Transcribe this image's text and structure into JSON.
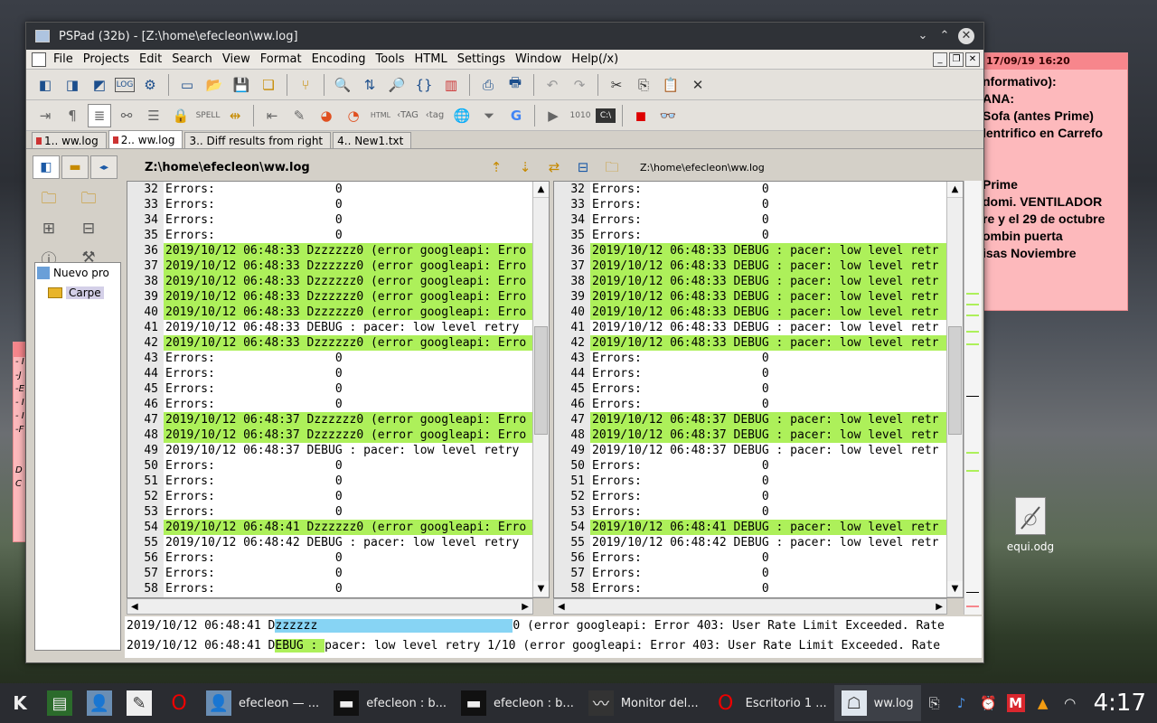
{
  "sticky_note": {
    "header": "17/09/19 16:20",
    "lines": [
      "nformativo):",
      "ANA:",
      "Sofa (antes Prime)",
      "lentrifico en Carrefo",
      "",
      "",
      "Prime",
      "domi. VENTILADOR",
      "re y el 29 de octubre",
      "ombin puerta",
      "isas Noviembre"
    ]
  },
  "left_sticky_lines": [
    "- I",
    "-J",
    "-E",
    "- I",
    "- I",
    "-F",
    "",
    "",
    "D",
    "C"
  ],
  "desktop_icon": {
    "label": "equi.odg"
  },
  "window": {
    "title": "PSPad (32b) - [Z:\\home\\efecleon\\ww.log]",
    "menu": [
      "File",
      "Projects",
      "Edit",
      "Search",
      "View",
      "Format",
      "Encoding",
      "Tools",
      "HTML",
      "Settings",
      "Window",
      "Help(/x)"
    ],
    "tabs": [
      {
        "label": "1.. ww.log",
        "active": false
      },
      {
        "label": "2.. ww.log",
        "active": true
      },
      {
        "label": "3.. Diff results from right",
        "active": false
      },
      {
        "label": "4.. New1.txt",
        "active": false
      }
    ],
    "path_left": "Z:\\home\\efecleon\\ww.log",
    "path_right": "Z:\\home\\efecleon\\ww.log",
    "tree": {
      "item1": "Nuevo pro",
      "item2": "Carpe"
    }
  },
  "left_pane": [
    {
      "n": "32",
      "t": "Errors:                 0",
      "hl": false
    },
    {
      "n": "33",
      "t": "Errors:                 0",
      "hl": false
    },
    {
      "n": "34",
      "t": "Errors:                 0",
      "hl": false
    },
    {
      "n": "35",
      "t": "Errors:                 0",
      "hl": false
    },
    {
      "n": "36",
      "t": "2019/10/12 06:48:33 Dzzzzzz0 (error googleapi: Erro",
      "hl": true
    },
    {
      "n": "37",
      "t": "2019/10/12 06:48:33 Dzzzzzz0 (error googleapi: Erro",
      "hl": true
    },
    {
      "n": "38",
      "t": "2019/10/12 06:48:33 Dzzzzzz0 (error googleapi: Erro",
      "hl": true
    },
    {
      "n": "39",
      "t": "2019/10/12 06:48:33 Dzzzzzz0 (error googleapi: Erro",
      "hl": true
    },
    {
      "n": "40",
      "t": "2019/10/12 06:48:33 Dzzzzzz0 (error googleapi: Erro",
      "hl": true
    },
    {
      "n": "41",
      "t": "2019/10/12 06:48:33 DEBUG : pacer: low level retry ",
      "hl": false
    },
    {
      "n": "42",
      "t": "2019/10/12 06:48:33 Dzzzzzz0 (error googleapi: Erro",
      "hl": true
    },
    {
      "n": "43",
      "t": "Errors:                 0",
      "hl": false
    },
    {
      "n": "44",
      "t": "Errors:                 0",
      "hl": false
    },
    {
      "n": "45",
      "t": "Errors:                 0",
      "hl": false
    },
    {
      "n": "46",
      "t": "Errors:                 0",
      "hl": false
    },
    {
      "n": "47",
      "t": "2019/10/12 06:48:37 Dzzzzzz0 (error googleapi: Erro",
      "hl": true
    },
    {
      "n": "48",
      "t": "2019/10/12 06:48:37 Dzzzzzz0 (error googleapi: Erro",
      "hl": true
    },
    {
      "n": "49",
      "t": "2019/10/12 06:48:37 DEBUG : pacer: low level retry ",
      "hl": false
    },
    {
      "n": "50",
      "t": "Errors:                 0",
      "hl": false
    },
    {
      "n": "51",
      "t": "Errors:                 0",
      "hl": false
    },
    {
      "n": "52",
      "t": "Errors:                 0",
      "hl": false
    },
    {
      "n": "53",
      "t": "Errors:                 0",
      "hl": false
    },
    {
      "n": "54",
      "t": "2019/10/12 06:48:41 Dzzzzzz0 (error googleapi: Erro",
      "hl": true
    },
    {
      "n": "55",
      "t": "2019/10/12 06:48:42 DEBUG : pacer: low level retry ",
      "hl": false
    },
    {
      "n": "56",
      "t": "Errors:                 0",
      "hl": false
    },
    {
      "n": "57",
      "t": "Errors:                 0",
      "hl": false
    },
    {
      "n": "58",
      "t": "Errors:                 0",
      "hl": false
    }
  ],
  "right_pane": [
    {
      "n": "32",
      "t": "Errors:                 0",
      "hl": false
    },
    {
      "n": "33",
      "t": "Errors:                 0",
      "hl": false
    },
    {
      "n": "34",
      "t": "Errors:                 0",
      "hl": false
    },
    {
      "n": "35",
      "t": "Errors:                 0",
      "hl": false
    },
    {
      "n": "36",
      "t": "2019/10/12 06:48:33 DEBUG : pacer: low level retr",
      "hl": true
    },
    {
      "n": "37",
      "t": "2019/10/12 06:48:33 DEBUG : pacer: low level retr",
      "hl": true
    },
    {
      "n": "38",
      "t": "2019/10/12 06:48:33 DEBUG : pacer: low level retr",
      "hl": true
    },
    {
      "n": "39",
      "t": "2019/10/12 06:48:33 DEBUG : pacer: low level retr",
      "hl": true
    },
    {
      "n": "40",
      "t": "2019/10/12 06:48:33 DEBUG : pacer: low level retr",
      "hl": true
    },
    {
      "n": "41",
      "t": "2019/10/12 06:48:33 DEBUG : pacer: low level retr",
      "hl": false
    },
    {
      "n": "42",
      "t": "2019/10/12 06:48:33 DEBUG : pacer: low level retr",
      "hl": true
    },
    {
      "n": "43",
      "t": "Errors:                 0",
      "hl": false
    },
    {
      "n": "44",
      "t": "Errors:                 0",
      "hl": false
    },
    {
      "n": "45",
      "t": "Errors:                 0",
      "hl": false
    },
    {
      "n": "46",
      "t": "Errors:                 0",
      "hl": false
    },
    {
      "n": "47",
      "t": "2019/10/12 06:48:37 DEBUG : pacer: low level retr",
      "hl": true
    },
    {
      "n": "48",
      "t": "2019/10/12 06:48:37 DEBUG : pacer: low level retr",
      "hl": true
    },
    {
      "n": "49",
      "t": "2019/10/12 06:48:37 DEBUG : pacer: low level retr",
      "hl": false
    },
    {
      "n": "50",
      "t": "Errors:                 0",
      "hl": false
    },
    {
      "n": "51",
      "t": "Errors:                 0",
      "hl": false
    },
    {
      "n": "52",
      "t": "Errors:                 0",
      "hl": false
    },
    {
      "n": "53",
      "t": "Errors:                 0",
      "hl": false
    },
    {
      "n": "54",
      "t": "2019/10/12 06:48:41 DEBUG : pacer: low level retr",
      "hl": true
    },
    {
      "n": "55",
      "t": "2019/10/12 06:48:42 DEBUG : pacer: low level retr",
      "hl": false
    },
    {
      "n": "56",
      "t": "Errors:                 0",
      "hl": false
    },
    {
      "n": "57",
      "t": "Errors:                 0",
      "hl": false
    },
    {
      "n": "58",
      "t": "Errors:                 0",
      "hl": false
    }
  ],
  "compare": {
    "line1_a": "2019/10/12 06:48:41 D",
    "line1_b": "zzzzzz",
    "line1_c": "0 (error googleapi: Error 403: User Rate Limit Exceeded. Rate",
    "line2_a": "2019/10/12 06:48:41 D",
    "line2_b": "EBUG : ",
    "line2_c": "pacer: low level retry 1/10 (error googleapi: Error 403: User Rate Limit Exceeded. Rate"
  },
  "taskbar": {
    "tasks": [
      "efecleon — ...",
      "efecleon : b...",
      "efecleon : b...",
      "Monitor del...",
      "Escritorio 1 ...",
      "ww.log"
    ],
    "clock": "4:17"
  },
  "colors": {
    "diff_green": "#adf05a",
    "selection_cyan": "#87d4f4",
    "sticky_pink": "#fdb9bc"
  }
}
